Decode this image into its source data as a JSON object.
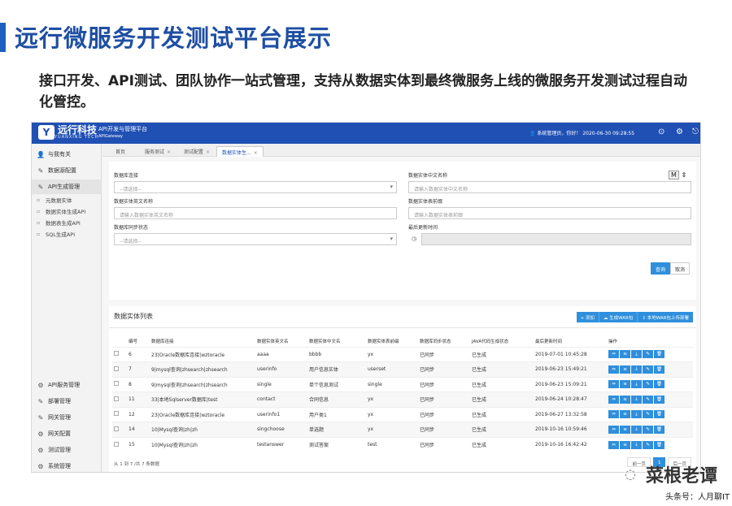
{
  "slide": {
    "title": "远行微服务开发测试平台展示",
    "subtitle": "接口开发、API测试、团队协作一站式管理，支持从数据实体到最终微服务上线的微服务开发测试过程自动化管控。"
  },
  "app": {
    "brand": "远行科技",
    "brand_en": "YUANXING TECH",
    "header_title": "API开发与管理平台",
    "header_sub": "APIGateway",
    "user_info": "系统管理员，你好！  2020-06-30 09:28:55",
    "top_icons": [
      "help-icon",
      "settings-icon",
      "exit-icon"
    ]
  },
  "sidebar": {
    "items": [
      {
        "label": "与我有关",
        "icon": "user-icon"
      },
      {
        "label": "数据源配置",
        "icon": "edit-icon"
      },
      {
        "label": "API生成管理",
        "icon": "edit-icon"
      }
    ],
    "subitems": [
      "元数据实体",
      "数据实体生成API",
      "数据表生成API",
      "SQL生成API"
    ],
    "bottom_items": [
      {
        "label": "API服务管理",
        "icon": "gear-icon"
      },
      {
        "label": "部署管理",
        "icon": "edit-icon"
      },
      {
        "label": "网关管理",
        "icon": "edit-icon"
      },
      {
        "label": "网关配置",
        "icon": "gear-icon"
      },
      {
        "label": "测试管理",
        "icon": "gear-icon"
      },
      {
        "label": "系统管理",
        "icon": "gear-icon"
      }
    ]
  },
  "tabs": [
    {
      "label": "首页",
      "closable": false
    },
    {
      "label": "服务测试",
      "closable": true
    },
    {
      "label": "测试配置",
      "closable": true
    },
    {
      "label": "数据实体生...",
      "closable": true
    }
  ],
  "filter": {
    "db_conn_label": "数据库连接",
    "db_conn_value": "--请选择--",
    "entity_en_label": "数据实体英文名称",
    "entity_en_placeholder": "请输入数据实体英文名称",
    "sync_label": "数据库同步状态",
    "sync_value": "--请选择--",
    "entity_cn_label": "数据实体中文名称",
    "entity_cn_placeholder": "请输入数据实体中文名称",
    "entity_table_label": "数据实体表前缀",
    "entity_table_placeholder": "请输入数据实体表前缀",
    "updated_label": "最后更新时间",
    "m_label": "M",
    "query_button": "查询",
    "cancel_button": "取消"
  },
  "list": {
    "title": "数据实体列表",
    "add_button": "+ 添加",
    "gen_war_button": "生成WAR包",
    "upload_war_button": "本地WAR包上传部署",
    "columns": [
      "",
      "编号",
      "数据库连接",
      "数据实体英文名",
      "数据实体中文名",
      "数据实体表前缀",
      "数据库同步状态",
      "JAVA代码生成状态",
      "最后更新时间",
      "操作"
    ],
    "rows": [
      [
        "6",
        "23|Oracle数据库连接|wztoracle",
        "aaaa",
        "bbbb",
        "yx",
        "已同步",
        "已生成",
        "2019-07-01 10:45:28"
      ],
      [
        "7",
        "9|mysql查询|zhsearch|zhsearch",
        "userinfo",
        "用户信息实体",
        "userset",
        "已同步",
        "已生成",
        "2019-06-23 15:49:21"
      ],
      [
        "8",
        "9|mysql查询|zhsearch|zhsearch",
        "single",
        "单个信息测试",
        "single",
        "已同步",
        "已生成",
        "2019-06-23 15:09:21"
      ],
      [
        "11",
        "33|本地Sqlserver数据库|test",
        "contact",
        "合同信息",
        "yx",
        "已同步",
        "已生成",
        "2019-06-24 10:28:47"
      ],
      [
        "12",
        "23|Oracle数据库连接|wztoracle",
        "userinfo1",
        "用户类1",
        "yx",
        "已同步",
        "已生成",
        "2019-06-27 13:32:58"
      ],
      [
        "14",
        "10|Mysql查询|zh|zh",
        "singchoose",
        "单选题",
        "yx",
        "已同步",
        "已生成",
        "2019-10-16 10:59:46"
      ],
      [
        "15",
        "10|Mysql查询|zh|zh",
        "testanswer",
        "测试答案",
        "test",
        "已同步",
        "已生成",
        "2019-10-16 16:42:42"
      ]
    ],
    "op_icons": [
      "link-icon",
      "list-icon",
      "download-icon",
      "edit-icon",
      "delete-icon"
    ],
    "page_info": "从 1 到 7 /共 7 条数据",
    "prev": "前一页",
    "current_page": "1",
    "next": "后一页"
  },
  "watermark": {
    "text": "菜根老谭",
    "credit": "头条号：人月聊IT"
  }
}
